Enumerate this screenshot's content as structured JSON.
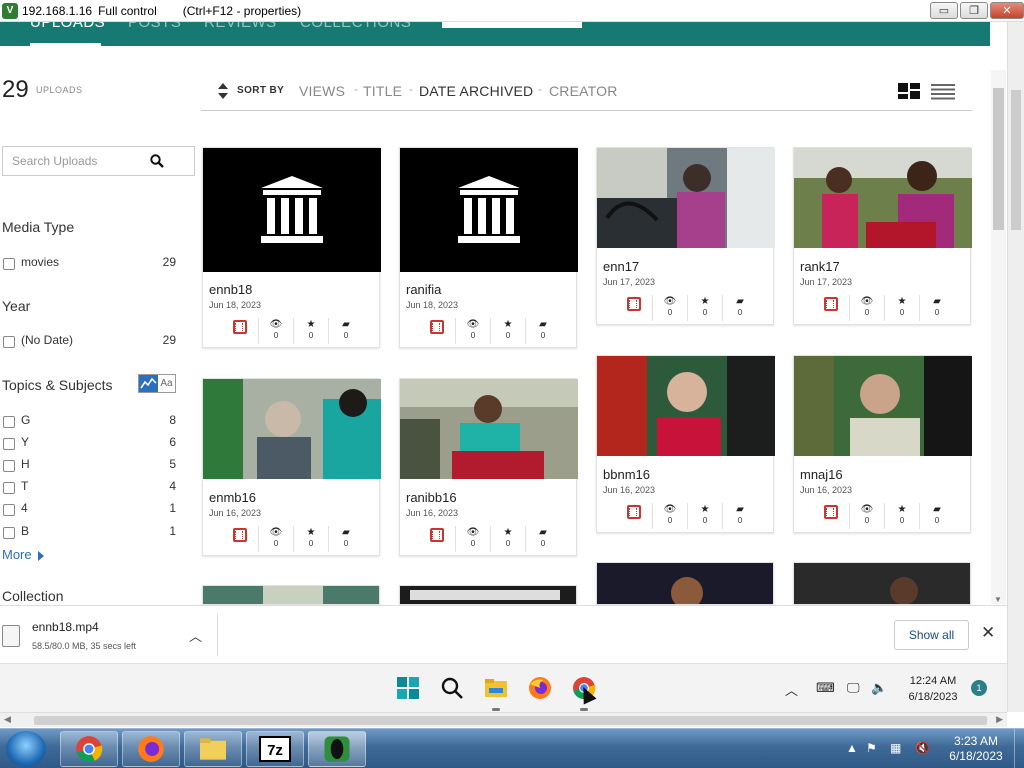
{
  "titlebar": {
    "ip": "192.168.1.16",
    "mode": "Full control",
    "hint": "(Ctrl+F12 - properties)",
    "minimize": "▭",
    "restore": "❐",
    "close": "✕"
  },
  "nav": {
    "tabs": [
      "UPLOADS",
      "POSTS",
      "REVIEWS",
      "COLLECTIONS"
    ],
    "active_tab": "UPLOADS"
  },
  "uploads": {
    "count": "29",
    "label": "UPLOADS"
  },
  "search": {
    "placeholder": "Search Uploads"
  },
  "facets": {
    "media_type": {
      "title": "Media Type",
      "items": [
        {
          "label": "movies",
          "count": "29"
        }
      ]
    },
    "year": {
      "title": "Year",
      "items": [
        {
          "label": "(No Date)",
          "count": "29"
        }
      ]
    },
    "topics": {
      "title": "Topics & Subjects",
      "toggle_text": "Aa",
      "items": [
        {
          "label": "G",
          "count": "8"
        },
        {
          "label": "Y",
          "count": "6"
        },
        {
          "label": "H",
          "count": "5"
        },
        {
          "label": "T",
          "count": "4"
        },
        {
          "label": "4",
          "count": "1"
        },
        {
          "label": "B",
          "count": "1"
        }
      ],
      "more": "More"
    },
    "collection": {
      "title": "Collection"
    }
  },
  "sortbar": {
    "sort_by": "SORT BY",
    "options": [
      "VIEWS",
      "TITLE",
      "DATE ARCHIVED",
      "CREATOR"
    ],
    "selected": "DATE ARCHIVED"
  },
  "tiles": [
    {
      "name": "ennb18",
      "date": "Jun 18, 2023",
      "views": "0",
      "favs": "0",
      "reviews": "0",
      "thumb": "institution"
    },
    {
      "name": "ranifia",
      "date": "Jun 18, 2023",
      "views": "0",
      "favs": "0",
      "reviews": "0",
      "thumb": "institution"
    },
    {
      "name": "enn17",
      "date": "Jun 17, 2023",
      "views": "0",
      "favs": "0",
      "reviews": "0",
      "thumb": "photo"
    },
    {
      "name": "rank17",
      "date": "Jun 17, 2023",
      "views": "0",
      "favs": "0",
      "reviews": "0",
      "thumb": "photo"
    },
    {
      "name": "enmb16",
      "date": "Jun 16, 2023",
      "views": "0",
      "favs": "0",
      "reviews": "0",
      "thumb": "photo"
    },
    {
      "name": "ranibb16",
      "date": "Jun 16, 2023",
      "views": "0",
      "favs": "0",
      "reviews": "0",
      "thumb": "photo"
    },
    {
      "name": "bbnm16",
      "date": "Jun 16, 2023",
      "views": "0",
      "favs": "0",
      "reviews": "0",
      "thumb": "photo"
    },
    {
      "name": "mnaj16",
      "date": "Jun 16, 2023",
      "views": "0",
      "favs": "0",
      "reviews": "0",
      "thumb": "photo"
    }
  ],
  "download": {
    "filename": "ennb18.mp4",
    "status": "58.5/80.0 MB, 35 secs left",
    "show_all": "Show all"
  },
  "remote_taskbar": {
    "time": "12:24 AM",
    "date": "6/18/2023",
    "badge": "1"
  },
  "local_taskbar": {
    "time": "3:23 AM",
    "date": "6/18/2023"
  },
  "colors": {
    "teal": "#167a73",
    "accent_blue": "#2c6fbf",
    "film_red": "#cc3333"
  }
}
